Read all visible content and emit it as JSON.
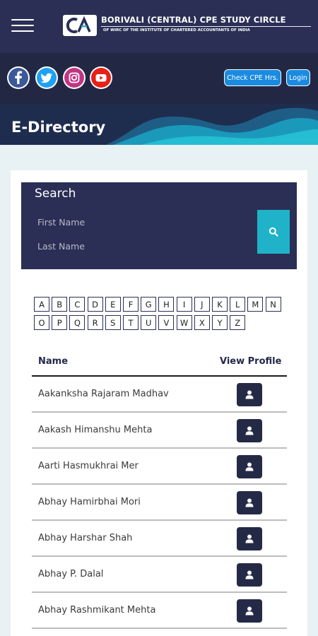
{
  "header": {
    "menu_icon": "hamburger-menu-icon",
    "logo_icon": "ca-logo-icon",
    "brand_title": "BORIVALI (CENTRAL) CPE STUDY CIRCLE",
    "brand_subtitle": "OF WIRC OF THE INSTITUTE OF CHARTERED ACCOUNTANTS OF INDIA"
  },
  "social": {
    "icons": [
      "facebook-icon",
      "twitter-icon",
      "instagram-icon",
      "youtube-icon"
    ],
    "check_cpe_label": "Check CPE Hrs.",
    "login_label": "Login"
  },
  "page": {
    "title": "E-Directory"
  },
  "search": {
    "title": "Search",
    "first_name_placeholder": "First Name",
    "last_name_placeholder": "Last Name",
    "button_icon": "search-icon"
  },
  "alphabet": {
    "row1": [
      "A",
      "B",
      "C",
      "D",
      "E",
      "F",
      "G",
      "H",
      "I",
      "J",
      "K",
      "L",
      "M",
      "N"
    ],
    "row2": [
      "O",
      "P",
      "Q",
      "R",
      "S",
      "T",
      "U",
      "V",
      "W",
      "X",
      "Y",
      "Z"
    ]
  },
  "table": {
    "col_name": "Name",
    "col_profile": "View Profile",
    "rows": [
      "Aakanksha Rajaram Madhav",
      "Aakash Himanshu Mehta",
      "Aarti Hasmukhrai Mer",
      "Abhay Hamirbhai Mori",
      "Abhay Harshar Shah",
      "Abhay P. Dalal",
      "Abhay Rashmikant Mehta"
    ],
    "profile_icon": "user-icon"
  },
  "colors": {
    "header_bg": "#2b2f55",
    "social_bg": "#222844",
    "button_blue": "#1a8be0",
    "search_teal": "#20b2c8",
    "page_bg": "#e8f1f3"
  }
}
